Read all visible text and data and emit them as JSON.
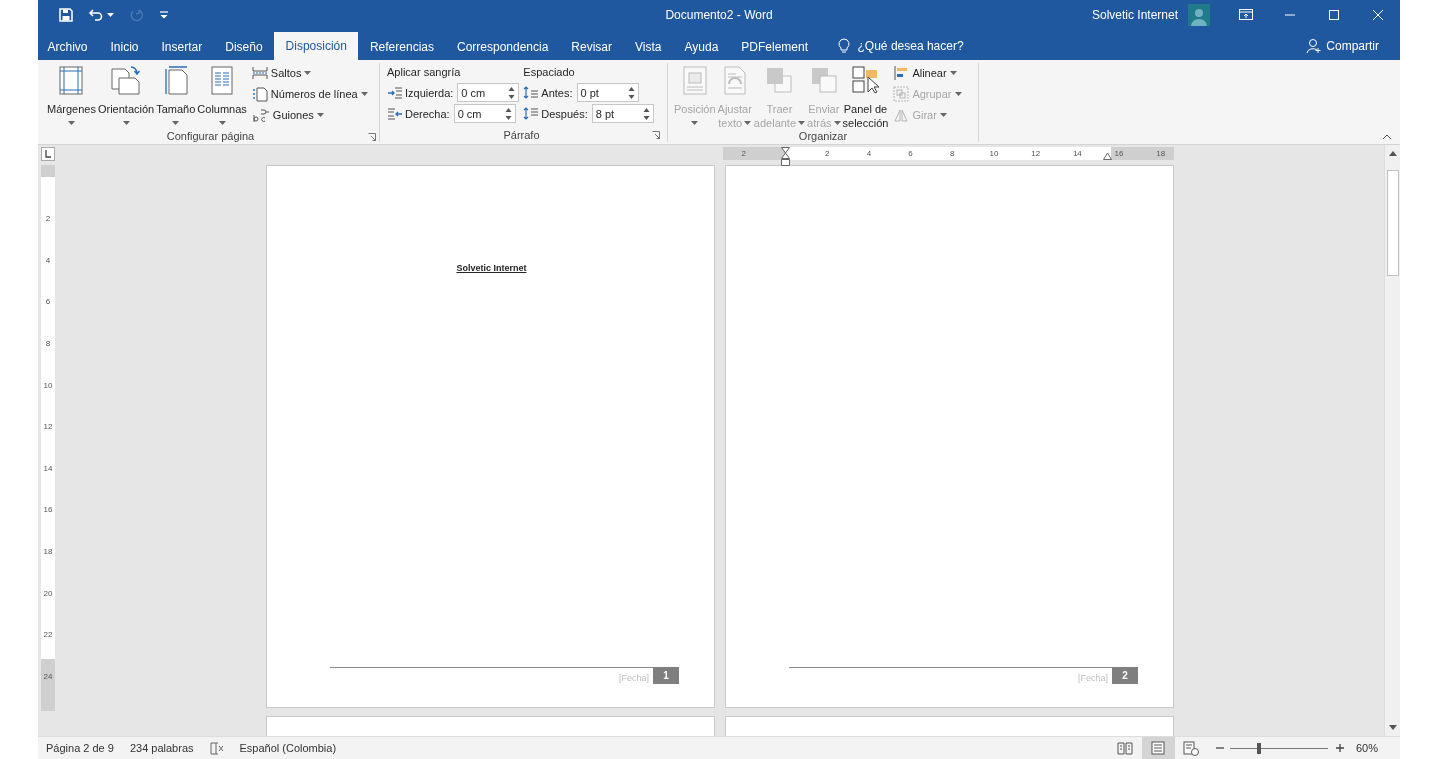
{
  "window": {
    "title": "Documento2 - Word",
    "user": "Solvetic Internet"
  },
  "quick_access": [
    {
      "kind": "save",
      "disabled": false,
      "dropdown": false
    },
    {
      "kind": "undo",
      "disabled": false,
      "dropdown": true
    },
    {
      "kind": "redo",
      "disabled": true,
      "dropdown": false
    },
    {
      "kind": "customize",
      "disabled": false,
      "dropdown": false
    }
  ],
  "tabs": [
    {
      "label": "Archivo",
      "selected": false
    },
    {
      "label": "Inicio",
      "selected": false
    },
    {
      "label": "Insertar",
      "selected": false
    },
    {
      "label": "Diseño",
      "selected": false
    },
    {
      "label": "Disposición",
      "selected": true
    },
    {
      "label": "Referencias",
      "selected": false
    },
    {
      "label": "Correspondencia",
      "selected": false
    },
    {
      "label": "Revisar",
      "selected": false
    },
    {
      "label": "Vista",
      "selected": false
    },
    {
      "label": "Ayuda",
      "selected": false
    },
    {
      "label": "PDFelement",
      "selected": false
    }
  ],
  "tell_me": "¿Qué desea hacer?",
  "share": "Compartir",
  "ribbon": {
    "page_setup": {
      "label": "Configurar página",
      "large_buttons": [
        {
          "kind": "margins",
          "lines": [
            "Márgenes"
          ],
          "dropdown": true,
          "disabled": false
        },
        {
          "kind": "orientation",
          "lines": [
            "Orientación"
          ],
          "dropdown": true,
          "disabled": false
        },
        {
          "kind": "size",
          "lines": [
            "Tamaño"
          ],
          "dropdown": true,
          "disabled": false
        },
        {
          "kind": "columns",
          "lines": [
            "Columnas"
          ],
          "dropdown": true,
          "disabled": false
        }
      ],
      "small_buttons": [
        {
          "kind": "breaks",
          "label": "Saltos",
          "dropdown": true,
          "disabled": false
        },
        {
          "kind": "line_numbers",
          "label": "Números de línea",
          "dropdown": true,
          "disabled": false
        },
        {
          "kind": "hyphenation",
          "label": "Guiones",
          "dropdown": true,
          "disabled": false
        }
      ]
    },
    "paragraph": {
      "label": "Párrafo",
      "columns": [
        {
          "title": "Aplicar sangría",
          "fields": [
            {
              "kind": "indent_left",
              "label": "Izquierda:",
              "value": "0 cm"
            },
            {
              "kind": "indent_right",
              "label": "Derecha:",
              "value": "0 cm"
            }
          ]
        },
        {
          "title": "Espaciado",
          "fields": [
            {
              "kind": "space_before",
              "label": "Antes:",
              "value": "0 pt"
            },
            {
              "kind": "space_after",
              "label": "Después:",
              "value": "8 pt"
            }
          ]
        }
      ]
    },
    "arrange": {
      "label": "Organizar",
      "large_buttons": [
        {
          "kind": "position",
          "lines": [
            "Posición"
          ],
          "dropdown": true,
          "disabled": true
        },
        {
          "kind": "wrap_text",
          "lines": [
            "Ajustar",
            "texto"
          ],
          "dropdown": true,
          "disabled": true
        },
        {
          "kind": "bring_forward",
          "lines": [
            "Traer",
            "adelante"
          ],
          "dropdown": true,
          "disabled": true
        },
        {
          "kind": "send_backward",
          "lines": [
            "Enviar",
            "atrás"
          ],
          "dropdown": true,
          "disabled": true
        },
        {
          "kind": "selection_pane",
          "lines": [
            "Panel de",
            "selección"
          ],
          "dropdown": false,
          "disabled": false
        }
      ],
      "small_buttons": [
        {
          "kind": "align",
          "label": "Alinear",
          "dropdown": true,
          "disabled": false
        },
        {
          "kind": "group",
          "label": "Agrupar",
          "dropdown": true,
          "disabled": true
        },
        {
          "kind": "rotate",
          "label": "Girar",
          "dropdown": true,
          "disabled": true
        }
      ]
    }
  },
  "rulers": {
    "horizontal_margin_labels": [
      "2"
    ],
    "horizontal_labels": [
      "2",
      "4",
      "6",
      "8",
      "10",
      "12",
      "14",
      "16",
      "18"
    ],
    "vertical_labels": [
      "2",
      "4",
      "6",
      "8",
      "10",
      "12",
      "14",
      "16",
      "18",
      "20",
      "22",
      "24"
    ]
  },
  "pages": [
    {
      "kind": "full",
      "heading": "Solvetic Internet",
      "footer_date": "[Fecha]",
      "page_number": "1"
    },
    {
      "kind": "full",
      "footer_date": "[Fecha]",
      "page_number": "2"
    },
    {
      "kind": "partial"
    },
    {
      "kind": "partial"
    }
  ],
  "status_bar": {
    "page": "Página 2 de 9",
    "words": "234 palabras",
    "language": "Español (Colombia)",
    "views": [
      {
        "kind": "read",
        "selected": false
      },
      {
        "kind": "print",
        "selected": true
      },
      {
        "kind": "web",
        "selected": false
      }
    ],
    "zoom": {
      "level": 0.3,
      "reading": "60%"
    }
  }
}
